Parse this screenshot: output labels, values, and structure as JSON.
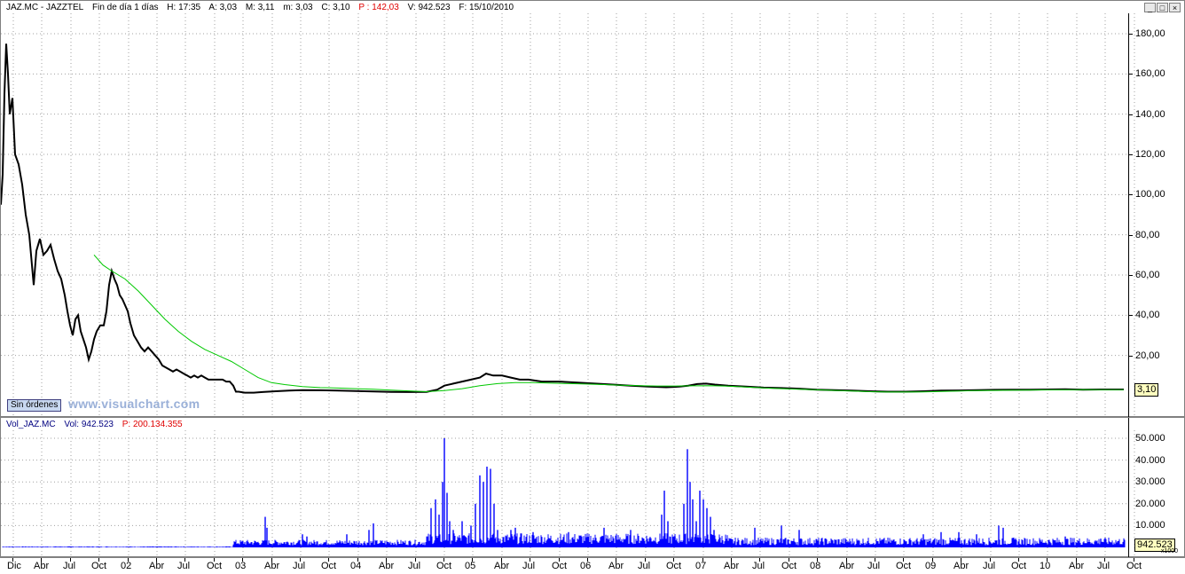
{
  "price_header": {
    "symbol": "JAZ.MC - JAZZTEL",
    "period": "Fin de día 1 días",
    "h": "H: 17:35",
    "a": "A: 3,03",
    "m": "M: 3,11",
    "lo": "m: 3,03",
    "c": "C: 3,10",
    "p": "P : 142,03",
    "v": "V: 942.523",
    "f": "F: 15/10/2010"
  },
  "vol_header": {
    "symbol": "Vol_JAZ.MC",
    "vol": "Vol: 942.523",
    "p": "P: 200.134.355"
  },
  "window_buttons": [
    "_",
    "□",
    "×"
  ],
  "sin_ordenes_label": "Sin órdenes",
  "watermark": "www.visualchart.com",
  "small_corner_label": "x1000",
  "colors": {
    "price_line": "#000000",
    "moving_average": "#00c800",
    "volume": "#0000ff",
    "grid": "#a0a0a0"
  },
  "chart_data": [
    {
      "type": "line",
      "name": "price",
      "y_ticks": [
        "180,00",
        "160,00",
        "140,00",
        "120,00",
        "100,00",
        "80,00",
        "60,00",
        "40,00",
        "20,00"
      ],
      "ylim": [
        0,
        185
      ],
      "last_value_label": "3,10",
      "x_labels": [
        "Dic",
        "Abr",
        "Jul",
        "Oct",
        "02",
        "Abr",
        "Jul",
        "Oct",
        "03",
        "Abr",
        "Jul",
        "Oct",
        "04",
        "Abr",
        "Jul",
        "Oct",
        "05",
        "Abr",
        "Jul",
        "Oct",
        "06",
        "Abr",
        "Jul",
        "Oct",
        "07",
        "Abr",
        "Jul",
        "Oct",
        "08",
        "Abr",
        "Jul",
        "Oct",
        "09",
        "Abr",
        "Jul",
        "Oct",
        "10",
        "Abr",
        "Jul",
        "Oct"
      ],
      "series": [
        {
          "values": [
            [
              0,
              95
            ],
            [
              2,
              110
            ],
            [
              4,
              150
            ],
            [
              6,
              175
            ],
            [
              8,
              160
            ],
            [
              10,
              140
            ],
            [
              13,
              148
            ],
            [
              16,
              120
            ],
            [
              20,
              115
            ],
            [
              24,
              105
            ],
            [
              28,
              90
            ],
            [
              32,
              80
            ],
            [
              35,
              65
            ],
            [
              37,
              55
            ],
            [
              40,
              72
            ],
            [
              44,
              78
            ],
            [
              48,
              70
            ],
            [
              52,
              72
            ],
            [
              56,
              75
            ],
            [
              60,
              68
            ],
            [
              64,
              62
            ],
            [
              68,
              58
            ],
            [
              72,
              50
            ],
            [
              75,
              42
            ],
            [
              78,
              35
            ],
            [
              81,
              30
            ],
            [
              84,
              38
            ],
            [
              87,
              40
            ],
            [
              90,
              32
            ],
            [
              93,
              28
            ],
            [
              96,
              24
            ],
            [
              99,
              18
            ],
            [
              102,
              22
            ],
            [
              105,
              28
            ],
            [
              108,
              32
            ],
            [
              112,
              35
            ],
            [
              116,
              35
            ],
            [
              119,
              42
            ],
            [
              122,
              55
            ],
            [
              125,
              62
            ],
            [
              128,
              58
            ],
            [
              131,
              55
            ],
            [
              134,
              50
            ],
            [
              137,
              48
            ],
            [
              140,
              45
            ],
            [
              143,
              42
            ],
            [
              146,
              36
            ],
            [
              150,
              30
            ],
            [
              154,
              27
            ],
            [
              158,
              24
            ],
            [
              162,
              22
            ],
            [
              166,
              24
            ],
            [
              170,
              22
            ],
            [
              174,
              20
            ],
            [
              178,
              18
            ],
            [
              182,
              15
            ],
            [
              186,
              14
            ],
            [
              190,
              13
            ],
            [
              194,
              12
            ],
            [
              198,
              13
            ],
            [
              202,
              12
            ],
            [
              206,
              11
            ],
            [
              210,
              10
            ],
            [
              214,
              9
            ],
            [
              218,
              10
            ],
            [
              222,
              9
            ],
            [
              226,
              10
            ],
            [
              230,
              9
            ],
            [
              234,
              8
            ],
            [
              238,
              8
            ],
            [
              242,
              8
            ],
            [
              246,
              8
            ],
            [
              250,
              8
            ],
            [
              254,
              7
            ],
            [
              258,
              7
            ],
            [
              262,
              5
            ],
            [
              265,
              2
            ],
            [
              268,
              2
            ],
            [
              275,
              1.5
            ],
            [
              285,
              1.5
            ],
            [
              295,
              1.8
            ],
            [
              310,
              2.2
            ],
            [
              325,
              2.5
            ],
            [
              340,
              2.8
            ],
            [
              360,
              2.7
            ],
            [
              380,
              2.5
            ],
            [
              400,
              2.3
            ],
            [
              420,
              2.1
            ],
            [
              440,
              1.9
            ],
            [
              460,
              1.8
            ],
            [
              480,
              1.9
            ],
            [
              492,
              3
            ],
            [
              500,
              5
            ],
            [
              510,
              6
            ],
            [
              520,
              7
            ],
            [
              530,
              8
            ],
            [
              540,
              9
            ],
            [
              547,
              11
            ],
            [
              555,
              10
            ],
            [
              565,
              10
            ],
            [
              575,
              9
            ],
            [
              585,
              8
            ],
            [
              595,
              8
            ],
            [
              610,
              7
            ],
            [
              630,
              7
            ],
            [
              650,
              6.5
            ],
            [
              670,
              6
            ],
            [
              690,
              5.5
            ],
            [
              710,
              5
            ],
            [
              730,
              4.5
            ],
            [
              750,
              4.2
            ],
            [
              765,
              4.5
            ],
            [
              775,
              5
            ],
            [
              785,
              5.8
            ],
            [
              795,
              6
            ],
            [
              805,
              5.5
            ],
            [
              820,
              5
            ],
            [
              840,
              4.5
            ],
            [
              860,
              4
            ],
            [
              880,
              3.8
            ],
            [
              900,
              3.5
            ],
            [
              920,
              3
            ],
            [
              940,
              2.8
            ],
            [
              960,
              2.5
            ],
            [
              980,
              2.2
            ],
            [
              1000,
              2
            ],
            [
              1020,
              2
            ],
            [
              1040,
              2.2
            ],
            [
              1060,
              2.5
            ],
            [
              1080,
              2.6
            ],
            [
              1100,
              2.8
            ],
            [
              1120,
              2.9
            ],
            [
              1140,
              3
            ],
            [
              1160,
              3
            ],
            [
              1180,
              3.1
            ],
            [
              1200,
              3.2
            ],
            [
              1220,
              3
            ],
            [
              1240,
              3.1
            ],
            [
              1266,
              3.1
            ]
          ]
        },
        {
          "values": [
            [
              105,
              70
            ],
            [
              115,
              65
            ],
            [
              125,
              62
            ],
            [
              140,
              58
            ],
            [
              155,
              52
            ],
            [
              170,
              45
            ],
            [
              185,
              38
            ],
            [
              200,
              32
            ],
            [
              215,
              27
            ],
            [
              230,
              23
            ],
            [
              245,
              20
            ],
            [
              260,
              17
            ],
            [
              275,
              13
            ],
            [
              290,
              9
            ],
            [
              305,
              6.5
            ],
            [
              320,
              5.5
            ],
            [
              340,
              4.5
            ],
            [
              360,
              4
            ],
            [
              380,
              3.8
            ],
            [
              400,
              3.5
            ],
            [
              420,
              3.2
            ],
            [
              440,
              2.8
            ],
            [
              460,
              2.4
            ],
            [
              480,
              2
            ],
            [
              500,
              2.5
            ],
            [
              520,
              3.5
            ],
            [
              540,
              5
            ],
            [
              560,
              6
            ],
            [
              580,
              6.5
            ],
            [
              600,
              6.5
            ],
            [
              620,
              6.2
            ],
            [
              640,
              6
            ],
            [
              660,
              5.8
            ],
            [
              680,
              5.5
            ],
            [
              700,
              5.2
            ],
            [
              720,
              5
            ],
            [
              740,
              4.8
            ],
            [
              760,
              4.8
            ],
            [
              780,
              4.9
            ],
            [
              800,
              5
            ],
            [
              820,
              4.7
            ],
            [
              840,
              4.3
            ],
            [
              860,
              3.9
            ],
            [
              880,
              3.5
            ],
            [
              900,
              3.2
            ],
            [
              920,
              2.9
            ],
            [
              940,
              2.6
            ],
            [
              960,
              2.3
            ],
            [
              980,
              2
            ],
            [
              1000,
              1.8
            ],
            [
              1020,
              1.8
            ],
            [
              1040,
              1.9
            ],
            [
              1060,
              2.1
            ],
            [
              1080,
              2.3
            ],
            [
              1100,
              2.5
            ],
            [
              1120,
              2.6
            ],
            [
              1140,
              2.7
            ],
            [
              1160,
              2.8
            ],
            [
              1180,
              2.9
            ],
            [
              1200,
              2.9
            ],
            [
              1220,
              3
            ],
            [
              1240,
              3
            ],
            [
              1266,
              3
            ]
          ]
        }
      ]
    },
    {
      "type": "bar",
      "name": "volume",
      "y_ticks": [
        "50.000",
        "40.000",
        "30.000",
        "20.000",
        "10.000"
      ],
      "ylim": [
        0,
        52000
      ],
      "last_value_label": "942.523",
      "spikes": [
        [
          298,
          14000
        ],
        [
          300,
          9000
        ],
        [
          340,
          6000
        ],
        [
          345,
          5000
        ],
        [
          390,
          6000
        ],
        [
          415,
          8000
        ],
        [
          420,
          11000
        ],
        [
          485,
          18000
        ],
        [
          490,
          22000
        ],
        [
          494,
          15000
        ],
        [
          498,
          30000
        ],
        [
          500,
          50000
        ],
        [
          503,
          25000
        ],
        [
          506,
          12000
        ],
        [
          510,
          8000
        ],
        [
          520,
          12000
        ],
        [
          530,
          10000
        ],
        [
          535,
          20000
        ],
        [
          540,
          33000
        ],
        [
          544,
          30000
        ],
        [
          548,
          37000
        ],
        [
          552,
          36000
        ],
        [
          556,
          20000
        ],
        [
          560,
          8000
        ],
        [
          575,
          8000
        ],
        [
          580,
          9000
        ],
        [
          600,
          7000
        ],
        [
          640,
          7000
        ],
        [
          680,
          9000
        ],
        [
          710,
          8000
        ],
        [
          745,
          15000
        ],
        [
          748,
          26000
        ],
        [
          752,
          12000
        ],
        [
          760,
          5000
        ],
        [
          770,
          20000
        ],
        [
          774,
          45000
        ],
        [
          777,
          30000
        ],
        [
          780,
          22000
        ],
        [
          784,
          12000
        ],
        [
          788,
          26000
        ],
        [
          792,
          22000
        ],
        [
          796,
          18000
        ],
        [
          800,
          14000
        ],
        [
          804,
          8000
        ],
        [
          850,
          9000
        ],
        [
          880,
          10000
        ],
        [
          900,
          8000
        ],
        [
          1040,
          6000
        ],
        [
          1060,
          7000
        ],
        [
          1080,
          7000
        ],
        [
          1100,
          6000
        ],
        [
          1125,
          10000
        ],
        [
          1130,
          9000
        ],
        [
          1200,
          5000
        ],
        [
          1240,
          4000
        ],
        [
          1266,
          2000
        ]
      ]
    }
  ]
}
